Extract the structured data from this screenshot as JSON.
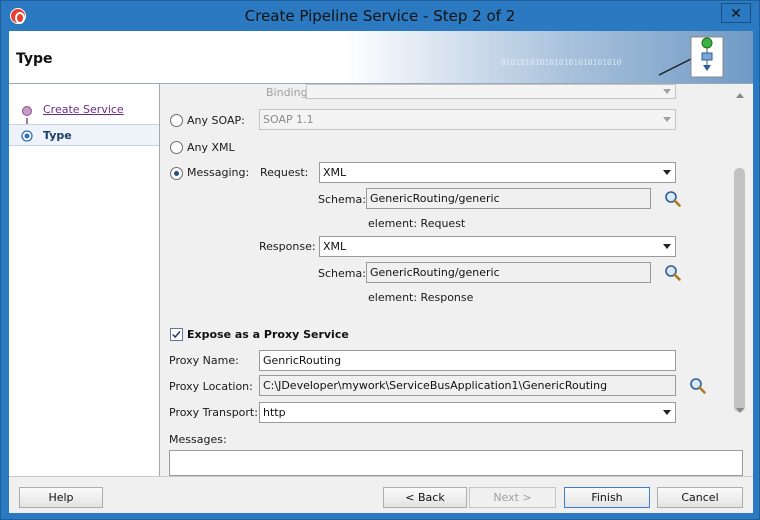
{
  "window": {
    "title": "Create Pipeline Service - Step 2 of 2",
    "close_glyph": "✕"
  },
  "header": {
    "title": "Type",
    "binary_decoration": "0101010101010101010101010"
  },
  "steps": [
    {
      "label": "Create Service",
      "state": "visited"
    },
    {
      "label": "Type",
      "state": "current"
    }
  ],
  "form": {
    "binding_label": "Binding:",
    "any_soap": {
      "label": "Any SOAP:",
      "value": "SOAP 1.1",
      "selected": false
    },
    "any_xml": {
      "label": "Any XML",
      "selected": false
    },
    "messaging": {
      "label": "Messaging:",
      "selected": true,
      "request": {
        "label": "Request:",
        "value": "XML",
        "schema_label": "Schema:",
        "schema_value": "GenericRouting/generic",
        "element_text": "element: Request"
      },
      "response": {
        "label": "Response:",
        "value": "XML",
        "schema_label": "Schema:",
        "schema_value": "GenericRouting/generic",
        "element_text": "element: Response"
      }
    },
    "expose": {
      "label": "Expose as a Proxy Service",
      "checked": true
    },
    "proxy_name": {
      "label": "Proxy Name:",
      "value": "GenricRouting"
    },
    "proxy_location": {
      "label": "Proxy Location:",
      "value": "C:\\JDeveloper\\mywork\\ServiceBusApplication1\\GenericRouting"
    },
    "proxy_transport": {
      "label": "Proxy Transport:",
      "value": "http"
    },
    "messages_label": "Messages:"
  },
  "buttons": {
    "help": "Help",
    "back": "< Back",
    "next": "Next >",
    "finish": "Finish",
    "cancel": "Cancel"
  },
  "colors": {
    "title_bar": "#2b79c1",
    "link": "#6b2a86",
    "current_step": "#1b3d6e"
  }
}
